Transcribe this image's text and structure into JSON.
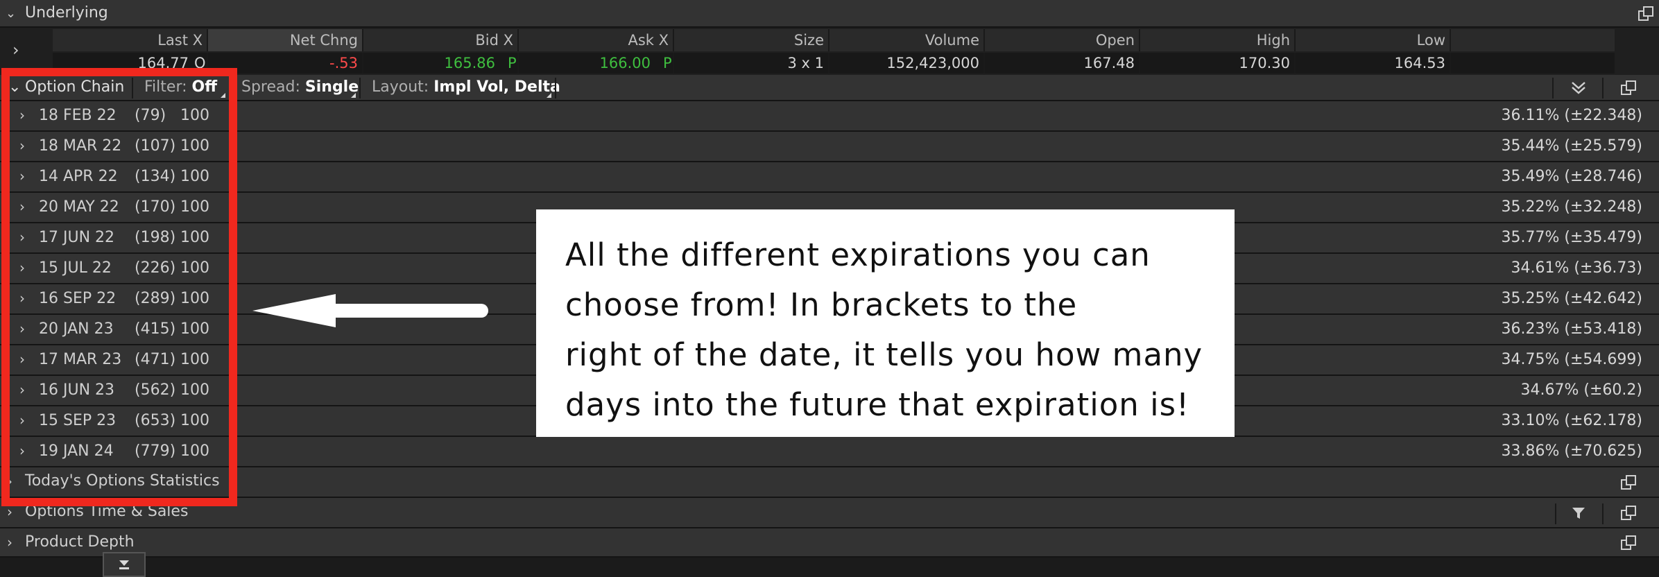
{
  "underlying": {
    "title": "Underlying",
    "headers": [
      "Last X",
      "Net Chng",
      "Bid X",
      "Ask X",
      "Size",
      "Volume",
      "Open",
      "High",
      "Low"
    ],
    "values": {
      "last": "164.77",
      "last_flag": "Q",
      "net_chng": "-.53",
      "bid": "165.86",
      "bid_flag": "P",
      "ask": "166.00",
      "ask_flag": "P",
      "size": "3 x 1",
      "volume": "152,423,000",
      "open": "167.48",
      "high": "170.30",
      "low": "164.53"
    }
  },
  "chain_toolbar": {
    "title": "Option Chain",
    "filter_label": "Filter:",
    "filter_value": "Off",
    "spread_label": "Spread:",
    "spread_value": "Single",
    "layout_label": "Layout:",
    "layout_value": "Impl Vol, Delta"
  },
  "expirations": [
    {
      "date": "18 FEB 22",
      "days": "(79)",
      "multiplier": "100",
      "impl_vol": "36.11% (±22.348)"
    },
    {
      "date": "18 MAR 22",
      "days": "(107)",
      "multiplier": "100",
      "impl_vol": "35.44% (±25.579)"
    },
    {
      "date": "14 APR 22",
      "days": "(134)",
      "multiplier": "100",
      "impl_vol": "35.49% (±28.746)"
    },
    {
      "date": "20 MAY 22",
      "days": "(170)",
      "multiplier": "100",
      "impl_vol": "35.22% (±32.248)"
    },
    {
      "date": "17 JUN 22",
      "days": "(198)",
      "multiplier": "100",
      "impl_vol": "35.77% (±35.479)"
    },
    {
      "date": "15 JUL 22",
      "days": "(226)",
      "multiplier": "100",
      "impl_vol": "34.61% (±36.73)"
    },
    {
      "date": "16 SEP 22",
      "days": "(289)",
      "multiplier": "100",
      "impl_vol": "35.25% (±42.642)"
    },
    {
      "date": "20 JAN 23",
      "days": "(415)",
      "multiplier": "100",
      "impl_vol": "36.23% (±53.418)"
    },
    {
      "date": "17 MAR 23",
      "days": "(471)",
      "multiplier": "100",
      "impl_vol": "34.75% (±54.699)"
    },
    {
      "date": "16 JUN 23",
      "days": "(562)",
      "multiplier": "100",
      "impl_vol": "34.67% (±60.2)"
    },
    {
      "date": "15 SEP 23",
      "days": "(653)",
      "multiplier": "100",
      "impl_vol": "33.10% (±62.178)"
    },
    {
      "date": "19 JAN 24",
      "days": "(779)",
      "multiplier": "100",
      "impl_vol": "33.86% (±70.625)"
    }
  ],
  "panels": {
    "stats": "Today's Options Statistics",
    "time_sales": "Options Time & Sales",
    "depth": "Product Depth"
  },
  "annotation": {
    "text": "All the different expirations you can choose from! In brackets to the right of the date, it tells you how many days into the future that expiration is!",
    "line1": "All the different expirations you can",
    "line2": "choose from! In brackets to the",
    "line3": "right of the date, it tells you how many",
    "line4": "days into the future that expiration is!"
  },
  "colors": {
    "negative": "#ff4a4a",
    "positive": "#3fbf3f",
    "highlight": "#f0281e"
  },
  "icons": {
    "collapse": "chevron-down-icon",
    "expand": "chevron-right-icon",
    "detach": "detach-window-icon",
    "filter": "filter-icon",
    "scroll_bottom": "scroll-to-bottom-icon"
  }
}
